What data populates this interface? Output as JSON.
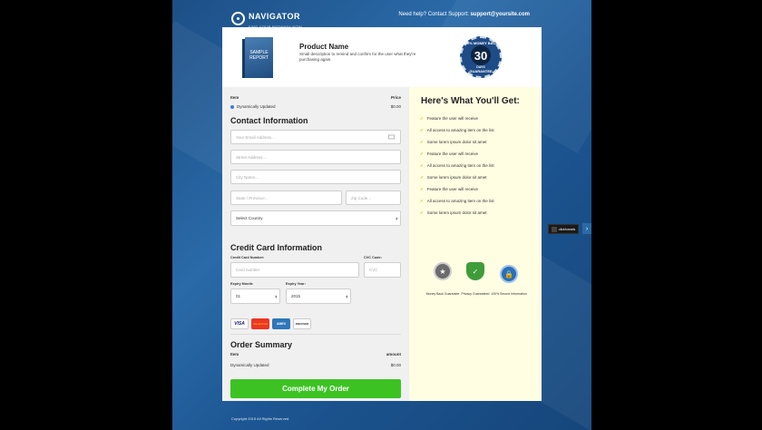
{
  "brand": {
    "name": "NAVIGATOR",
    "tagline": "FIND YOUR PATHWAY NOW"
  },
  "support": {
    "prefix": "Need help? Contact Support:",
    "email": "support@yoursite.com"
  },
  "product": {
    "book_label": "SAMPLE\nREPORT",
    "name": "Product Name",
    "description": "Small description to remind and confirm for the user what they're purchasing again."
  },
  "seal": {
    "top": "100% MONEY BACK",
    "number": "30",
    "unit": "DAYS",
    "bottom": "GUARANTEE"
  },
  "items_table": {
    "col_item": "Item",
    "col_price": "Price",
    "row_name": "Dynamically Updated",
    "row_price": "$0.00"
  },
  "contact": {
    "heading": "Contact Information",
    "email_placeholder": "Your Email Address...",
    "street_placeholder": "Street Address...",
    "city_placeholder": "City Name...",
    "state_placeholder": "State / Province...",
    "zip_placeholder": "Zip Code...",
    "country_value": "Select Country"
  },
  "credit_card": {
    "heading": "Credit Card Information",
    "number_label": "Credit Card Number:",
    "number_placeholder": "Card number",
    "cvc_label": "CVC Code:",
    "cvc_placeholder": "CVC",
    "month_label": "Expiry Month:",
    "month_value": "01",
    "year_label": "Expiry Year:",
    "year_value": "2015",
    "brands": [
      "VISA",
      "MasterCard",
      "AMEX",
      "DISCOVER"
    ]
  },
  "summary": {
    "heading": "Order Summary",
    "col_item": "Item",
    "col_amount": "amount",
    "row_name": "Dynamically Updated",
    "row_amount": "$0.00"
  },
  "cta": {
    "label": "Complete My Order"
  },
  "benefits": {
    "heading": "Here's What You'll Get:",
    "items": [
      "Feature the user will receive",
      "All access to amazing item on the list",
      "Some lorem ipsum dolor sit amet",
      "Feature the user will receive",
      "All access to amazing item on the list",
      "Some lorem ipsum dolor sit amet",
      "Feature the user will receive",
      "All access to amazing item on the list",
      "Some lorem ipsum dolor sit amet"
    ]
  },
  "trust_badges": [
    {
      "icon": "badge-seal-icon",
      "label": "Money Back Guarantee",
      "color": "#6b6b6b"
    },
    {
      "icon": "shield-check-icon",
      "label": "Privacy Guaranteed",
      "color": "#3f9c3a"
    },
    {
      "icon": "lock-icon",
      "label": "100% Secure Information",
      "color": "#2b6fb5"
    }
  ],
  "footer": {
    "copyright": "Copyright 2015 All Rights Reserved."
  },
  "side_widget": {
    "label": "clickfunnels"
  }
}
